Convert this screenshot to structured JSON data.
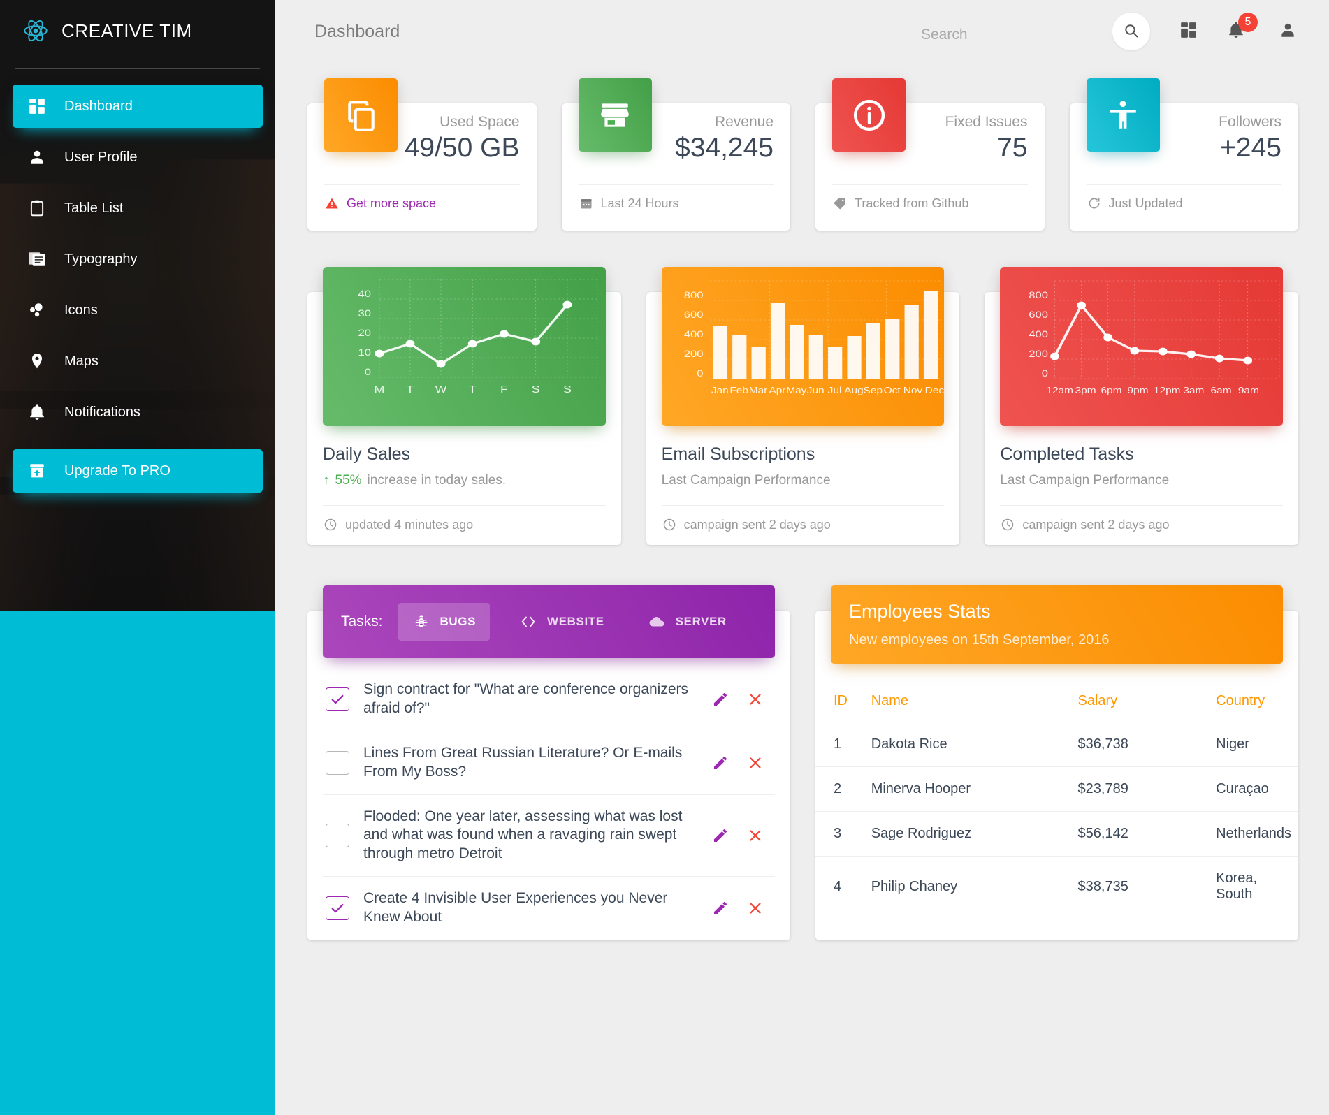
{
  "brand": {
    "title": "CREATIVE TIM",
    "logo_icon": "react-atom-icon"
  },
  "sidebar": {
    "items": [
      {
        "label": "Dashboard",
        "icon": "dashboard-grid-icon",
        "active": true
      },
      {
        "label": "User Profile",
        "icon": "person-icon",
        "active": false
      },
      {
        "label": "Table List",
        "icon": "clipboard-icon",
        "active": false
      },
      {
        "label": "Typography",
        "icon": "typography-icon",
        "active": false
      },
      {
        "label": "Icons",
        "icon": "bubbles-icon",
        "active": false
      },
      {
        "label": "Maps",
        "icon": "map-pin-icon",
        "active": false
      },
      {
        "label": "Notifications",
        "icon": "bell-icon",
        "active": false
      }
    ],
    "upgrade": {
      "label": "Upgrade To PRO",
      "icon": "unarchive-icon"
    }
  },
  "topbar": {
    "page_title": "Dashboard",
    "search_placeholder": "Search",
    "search_value": "",
    "search_icon": "search-icon",
    "apps_icon": "dashboard-grid-icon",
    "bell_icon": "bell-icon",
    "notification_count": "5",
    "person_icon": "person-icon"
  },
  "stats": [
    {
      "label": "Used Space",
      "value": "49/50 GB",
      "icon": "content-copy-icon",
      "color": "#ff9800",
      "foot": "Get more space",
      "foot_icon": "warning-icon",
      "foot_style": "warn"
    },
    {
      "label": "Revenue",
      "value": "$34,245",
      "icon": "store-icon",
      "color": "#4caf50",
      "foot": "Last 24 Hours",
      "foot_icon": "calendar-icon",
      "foot_style": "normal"
    },
    {
      "label": "Fixed Issues",
      "value": "75",
      "icon": "info-icon",
      "color": "#f44336",
      "foot": "Tracked from Github",
      "foot_icon": "tag-icon",
      "foot_style": "normal"
    },
    {
      "label": "Followers",
      "value": "+245",
      "icon": "accessibility-icon",
      "color": "#00bcd4",
      "foot": "Just Updated",
      "foot_icon": "update-icon",
      "foot_style": "normal"
    }
  ],
  "chart_cards": [
    {
      "title": "Daily Sales",
      "subtitle_accent": "55%",
      "subtitle_rest": "increase in today sales.",
      "foot": "updated 4 minutes ago",
      "foot_icon": "clock-icon",
      "color": "#4caf50"
    },
    {
      "title": "Email Subscriptions",
      "subtitle_accent": "",
      "subtitle_rest": "Last Campaign Performance",
      "foot": "campaign sent 2 days ago",
      "foot_icon": "clock-icon",
      "color": "#ff9800"
    },
    {
      "title": "Completed Tasks",
      "subtitle_accent": "",
      "subtitle_rest": "Last Campaign Performance",
      "foot": "campaign sent 2 days ago",
      "foot_icon": "clock-icon",
      "color": "#f44336"
    }
  ],
  "chart_data": [
    {
      "type": "line",
      "title": "Daily Sales",
      "categories": [
        "M",
        "T",
        "W",
        "T",
        "F",
        "S",
        "S"
      ],
      "values": [
        12,
        17,
        7,
        17,
        22,
        18,
        37
      ],
      "ylim": [
        0,
        45
      ],
      "yticks": [
        0,
        10,
        20,
        30,
        40
      ],
      "xlabel": "",
      "ylabel": "",
      "grid": true,
      "legend": "none",
      "series_color": "#ffffff",
      "background": "#4caf50"
    },
    {
      "type": "bar",
      "title": "Email Subscriptions",
      "categories": [
        "Jan",
        "Feb",
        "Mar",
        "Apr",
        "May",
        "Jun",
        "Jul",
        "Aug",
        "Sep",
        "Oct",
        "Nov",
        "Dec"
      ],
      "values": [
        542,
        443,
        320,
        780,
        553,
        453,
        326,
        434,
        568,
        610,
        756,
        895
      ],
      "ylim": [
        0,
        900
      ],
      "yticks": [
        0,
        200,
        400,
        600,
        800
      ],
      "xlabel": "",
      "ylabel": "",
      "grid": true,
      "legend": "none",
      "series_color": "#ffffff",
      "background": "#ff9800"
    },
    {
      "type": "line",
      "title": "Completed Tasks",
      "categories": [
        "12am",
        "3pm",
        "6pm",
        "9pm",
        "12pm",
        "3am",
        "6am",
        "9am"
      ],
      "values": [
        230,
        750,
        420,
        290,
        280,
        250,
        210,
        190
      ],
      "ylim": [
        0,
        900
      ],
      "yticks": [
        0,
        200,
        400,
        600,
        800
      ],
      "xlabel": "",
      "ylabel": "",
      "grid": true,
      "legend": "none",
      "series_color": "#ffffff",
      "background": "#f44336"
    }
  ],
  "tasks_panel": {
    "label": "Tasks:",
    "tabs": [
      {
        "label": "BUGS",
        "icon": "bug-icon",
        "active": true
      },
      {
        "label": "WEBSITE",
        "icon": "code-icon",
        "active": false
      },
      {
        "label": "SERVER",
        "icon": "cloud-icon",
        "active": false
      }
    ],
    "rows": [
      {
        "checked": true,
        "text": "Sign contract for \"What are conference organizers afraid of?\""
      },
      {
        "checked": false,
        "text": "Lines From Great Russian Literature? Or E-mails From My Boss?"
      },
      {
        "checked": false,
        "text": "Flooded: One year later, assessing what was lost and what was found when a ravaging rain swept through metro Detroit"
      },
      {
        "checked": true,
        "text": "Create 4 Invisible User Experiences you Never Knew About"
      }
    ],
    "edit_icon": "pencil-icon",
    "delete_icon": "close-x-icon"
  },
  "employees_panel": {
    "title": "Employees Stats",
    "subtitle": "New employees on 15th September, 2016",
    "columns": [
      "ID",
      "Name",
      "Salary",
      "Country"
    ],
    "rows": [
      [
        "1",
        "Dakota Rice",
        "$36,738",
        "Niger"
      ],
      [
        "2",
        "Minerva Hooper",
        "$23,789",
        "Curaçao"
      ],
      [
        "3",
        "Sage Rodriguez",
        "$56,142",
        "Netherlands"
      ],
      [
        "4",
        "Philip Chaney",
        "$38,735",
        "Korea, South"
      ]
    ]
  },
  "colors": {
    "accent": "#00bcd4",
    "orange": "#ff9800",
    "green": "#4caf50",
    "red": "#f44336",
    "purple": "#9c27b0",
    "page_bg": "#eeeeee",
    "text_dark": "#3c4858",
    "text_muted": "#999999"
  }
}
